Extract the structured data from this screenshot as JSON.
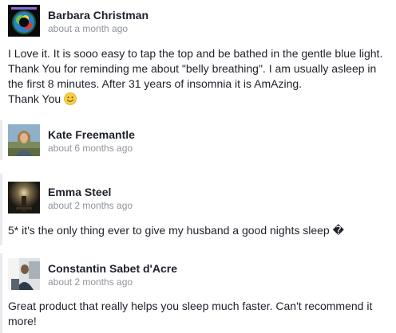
{
  "reviews": [
    {
      "author": "Barbara Christman",
      "time": "about a month ago",
      "avatar_icon": "globe-avatar",
      "lines": [
        "I Love it. It is sooo easy to tap the top and be bathed in the gentle blue light.",
        "Thank You for reminding me about \"belly breathing\". I am usually asleep in",
        "the first 8 minutes. After 31 years of insomnia it is AmAzing.",
        "Thank You"
      ],
      "emoji_icon": "smiley-emoji-icon"
    },
    {
      "author": "Kate Freemantle",
      "time": "about 6 months ago",
      "avatar_icon": "photo-avatar"
    },
    {
      "author": "Emma Steel",
      "time": "about 2 months ago",
      "avatar_icon": "dark-photo-avatar",
      "lines": [
        "5* it's the only thing ever to give my husband a good nights sleep �"
      ]
    },
    {
      "author": "Constantin Sabet d'Acre",
      "time": "about 2 months ago",
      "avatar_icon": "photo-avatar",
      "lines": [
        "Great product that really helps you sleep much faster. Can't recommend it",
        "more!"
      ]
    }
  ],
  "colors": {
    "name": "#1d2129",
    "timestamp": "#90949c",
    "text": "#1d2129"
  }
}
